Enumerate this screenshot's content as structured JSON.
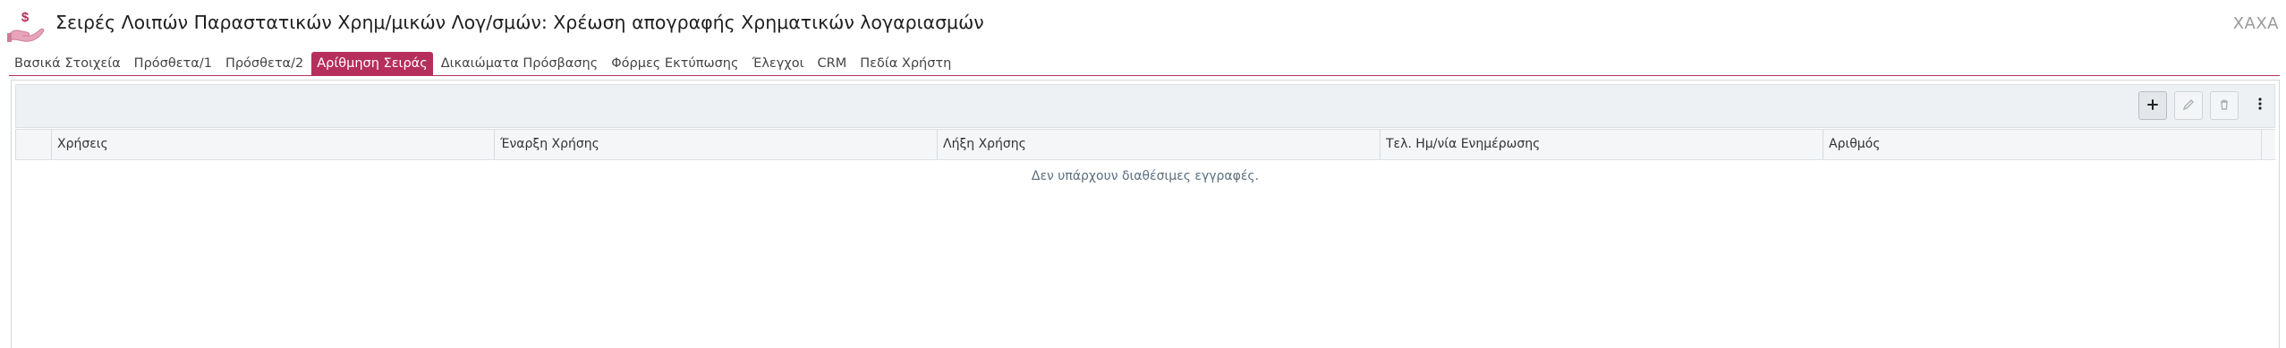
{
  "header": {
    "title": "Σειρές Λοιπών Παραστατικών Χρημ/μικών Λογ/σμών: Χρέωση απογραφής Χρηματικών λογαριασμών",
    "user": "ΧΑΧΑ",
    "icon": "money-hand-icon"
  },
  "tabs": [
    {
      "label": "Βασικά Στοιχεία",
      "active": false
    },
    {
      "label": "Πρόσθετα/1",
      "active": false
    },
    {
      "label": "Πρόσθετα/2",
      "active": false
    },
    {
      "label": "Αρίθμηση Σειράς",
      "active": true
    },
    {
      "label": "Δικαιώματα Πρόσβασης",
      "active": false
    },
    {
      "label": "Φόρμες Εκτύπωσης",
      "active": false
    },
    {
      "label": "Έλεγχοι",
      "active": false
    },
    {
      "label": "CRM",
      "active": false
    },
    {
      "label": "Πεδία Χρήστη",
      "active": false
    }
  ],
  "toolbar": {
    "add_icon": "plus-icon",
    "edit_icon": "pencil-icon",
    "delete_icon": "trash-icon",
    "more_icon": "more-vertical-icon"
  },
  "grid": {
    "columns": [
      "Χρήσεις",
      "Έναρξη Χρήσης",
      "Λήξη Χρήσης",
      "Τελ. Ημ/νία Ενημέρωσης",
      "Αριθμός"
    ],
    "empty_message": "Δεν υπάρχουν διαθέσιμες εγγραφές."
  },
  "colors": {
    "accent": "#b52e5c",
    "header_bg": "#f4f6f8"
  }
}
